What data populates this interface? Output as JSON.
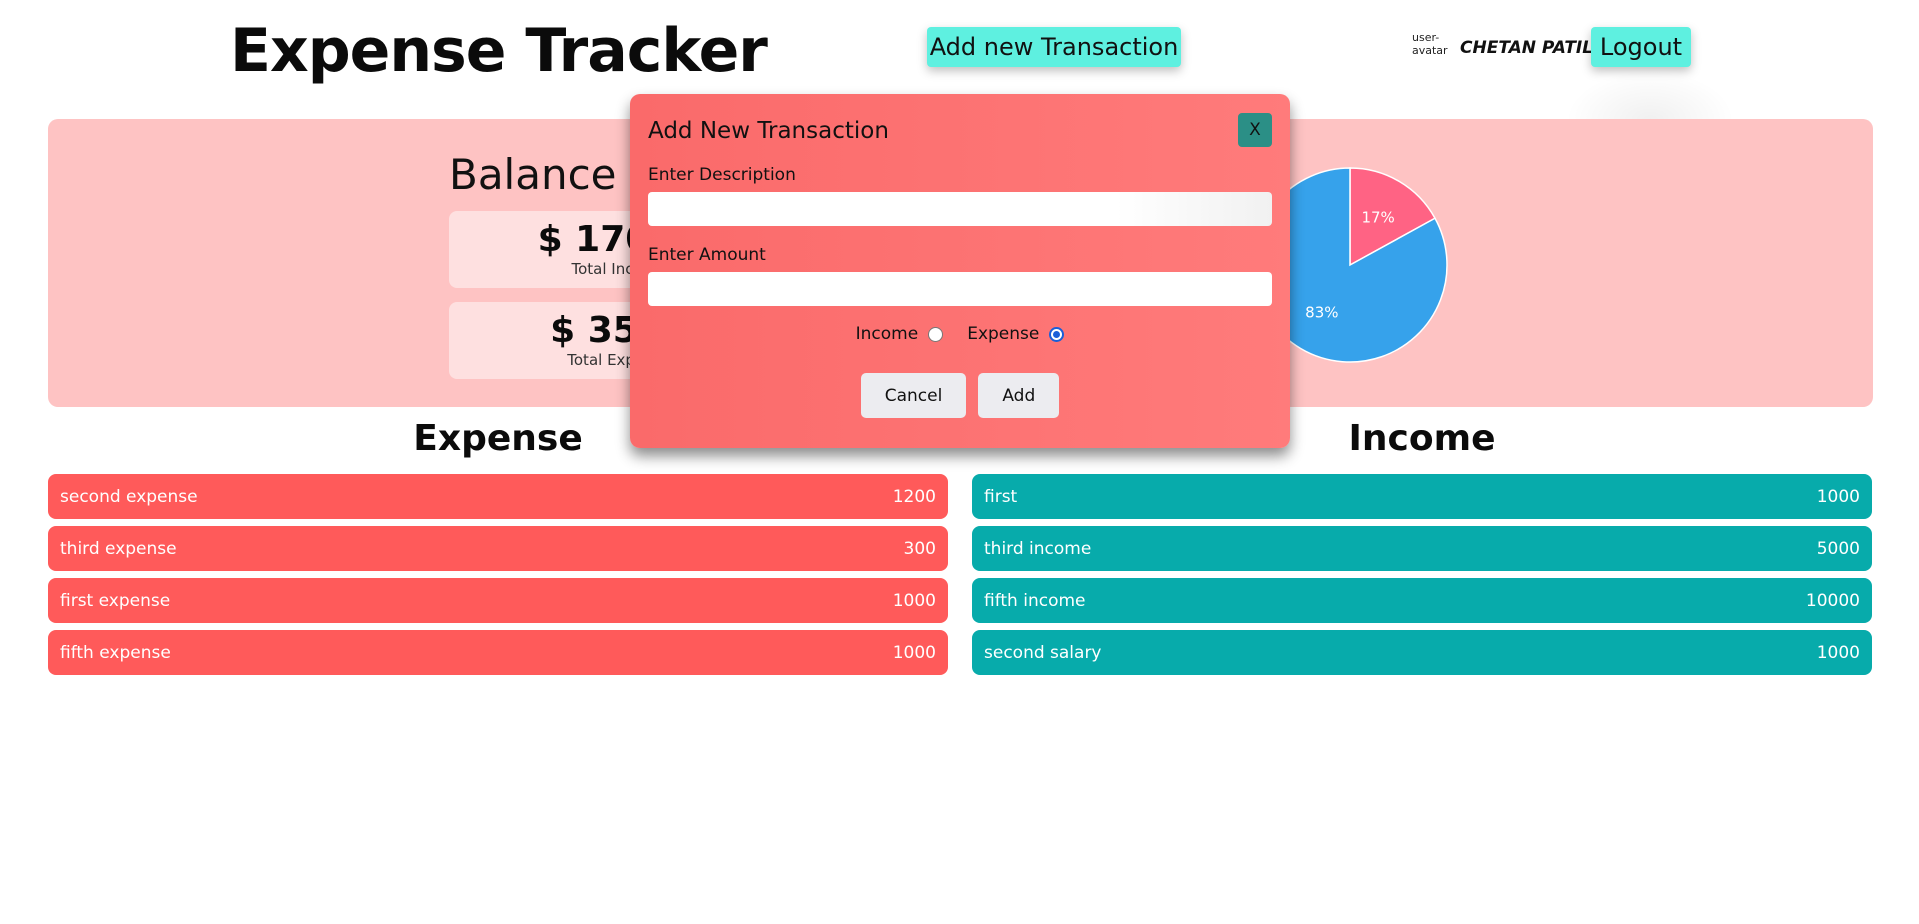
{
  "header": {
    "title": "Expense Tracker",
    "add_button": "Add new Transaction",
    "avatar_alt": "user-avatar",
    "username": "CHETAN PATIL",
    "logout_button": "Logout"
  },
  "summary": {
    "balance_title": "Balance is",
    "income_value": "$ 17000",
    "income_label": "Total Income",
    "expense_value": "$ 3500",
    "expense_label": "Total Expense"
  },
  "chart_data": {
    "type": "pie",
    "title": "",
    "labels": [
      "17%",
      "83%"
    ],
    "slices": [
      {
        "name": "",
        "value": 17,
        "color": "#ff6384"
      },
      {
        "name": "",
        "value": 83,
        "color": "#36a2eb"
      }
    ]
  },
  "expense": {
    "title": "Expense",
    "items": [
      {
        "description": "second expense",
        "amount": "1200"
      },
      {
        "description": "third expense",
        "amount": "300"
      },
      {
        "description": "first expense",
        "amount": "1000"
      },
      {
        "description": "fifth expense",
        "amount": "1000"
      }
    ]
  },
  "income": {
    "title": "Income",
    "items": [
      {
        "description": "first",
        "amount": "1000"
      },
      {
        "description": "third income",
        "amount": "5000"
      },
      {
        "description": "fifth income",
        "amount": "10000"
      },
      {
        "description": "second salary",
        "amount": "1000"
      }
    ]
  },
  "modal": {
    "title": "Add New Transaction",
    "close_label": "X",
    "description_label": "Enter Description",
    "description_value": "",
    "amount_label": "Enter Amount",
    "amount_value": "",
    "income_radio_label": "Income",
    "expense_radio_label": "Expense",
    "selected_type": "Expense",
    "cancel_button": "Cancel",
    "add_button": "Add"
  },
  "colors": {
    "accent_button": "#5ef0e0",
    "summary_bg": "#fec3c3",
    "expense_row": "#ff5a5a",
    "income_row": "#07abab",
    "modal_bg": "#ff7b7b"
  }
}
